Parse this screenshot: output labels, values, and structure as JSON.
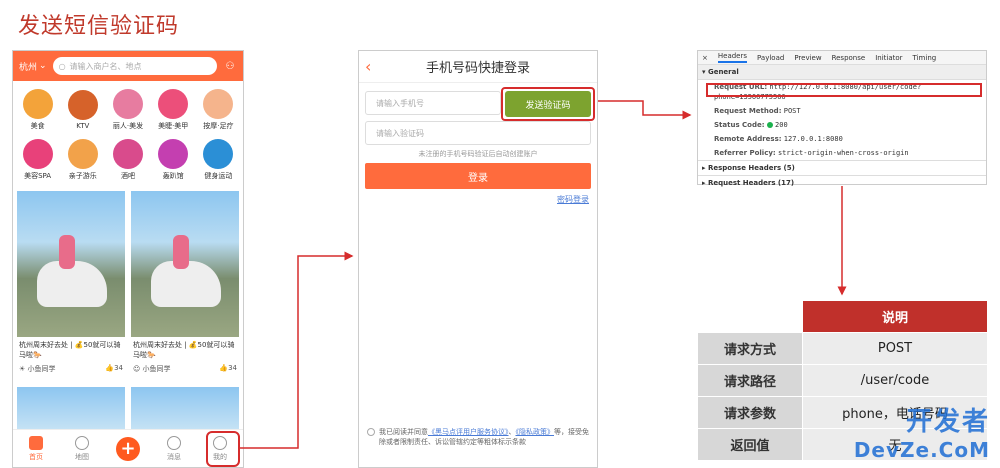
{
  "title": "发送短信验证码",
  "phone1": {
    "city": "杭州",
    "search_placeholder": "请输入商户名、地点",
    "categories": [
      "美食",
      "KTV",
      "丽人·美发",
      "美睫·美甲",
      "按摩·足疗",
      "美容SPA",
      "亲子游乐",
      "酒吧",
      "轰趴馆",
      "健身运动"
    ],
    "cards": [
      {
        "text": "杭州周末好去处 | 💰50就可以骑马啦🐎",
        "author": "小鱼同学",
        "likes": "34"
      },
      {
        "text": "杭州周末好去处 | 💰50就可以骑马啦🐎",
        "author": "小鱼同学",
        "likes": "34"
      }
    ],
    "tabs": [
      "首页",
      "地图",
      "+",
      "消息",
      "我的"
    ]
  },
  "phone2": {
    "title": "手机号码快捷登录",
    "phone_placeholder": "请输入手机号",
    "code_placeholder": "请输入验证码",
    "send_button": "发送验证码",
    "hint": "未注册的手机号码验证后自动创建账户",
    "login_button": "登录",
    "password_login": "密码登录",
    "agree_prefix": "我已阅读并同意",
    "agree_link1": "《黑马点评用户服务协议》",
    "agree_sep": "、",
    "agree_link2": "《隐私政策》",
    "agree_suffix": "等，接受免除或者限制责任、诉讼管辖约定等粗体标示条款"
  },
  "devtools": {
    "tabs": [
      "×",
      "Headers",
      "Payload",
      "Preview",
      "Response",
      "Initiator",
      "Timing"
    ],
    "general_label": "▾ General",
    "rows": [
      {
        "k": "Request URL:",
        "v": "http://127.0.0.1:8080/api/user/code?phone=13566775566"
      },
      {
        "k": "Request Method:",
        "v": "POST"
      },
      {
        "k": "Status Code:",
        "v": "200"
      },
      {
        "k": "Remote Address:",
        "v": "127.0.0.1:8080"
      },
      {
        "k": "Referrer Policy:",
        "v": "strict-origin-when-cross-origin"
      }
    ],
    "response_headers": "▸ Response Headers (5)",
    "request_headers": "▸ Request Headers (17)"
  },
  "table": {
    "header": "说明",
    "rows": [
      {
        "k": "请求方式",
        "v": "POST"
      },
      {
        "k": "请求路径",
        "v": "/user/code"
      },
      {
        "k": "请求参数",
        "v": "phone，电话号码"
      },
      {
        "k": "返回值",
        "v": "无"
      }
    ]
  },
  "watermark": {
    "line1": "开发者",
    "line2": "DevZe.CoM"
  },
  "colors": {
    "accent": "#ff6b3d",
    "highlight": "#d62c2c",
    "send": "#7da32f",
    "table_head": "#c0302b"
  }
}
